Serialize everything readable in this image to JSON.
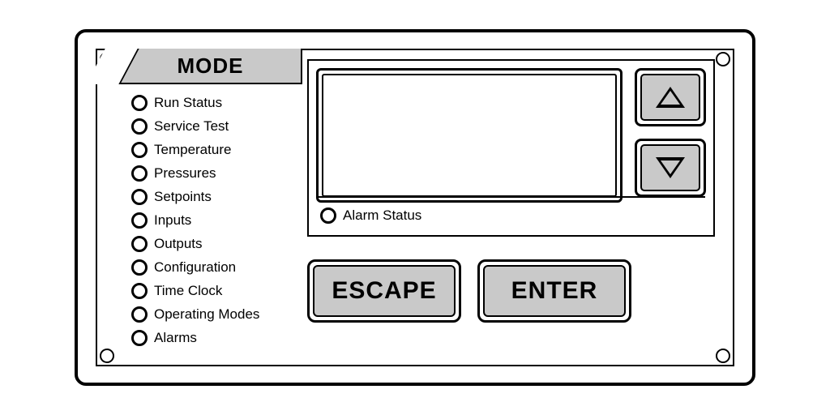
{
  "mode_header": "MODE",
  "mode_items": [
    "Run Status",
    "Service Test",
    "Temperature",
    "Pressures",
    "Setpoints",
    "Inputs",
    "Outputs",
    "Configuration",
    "Time Clock",
    "Operating Modes",
    "Alarms"
  ],
  "alarm_status_label": "Alarm Status",
  "buttons": {
    "escape": "ESCAPE",
    "enter": "ENTER"
  }
}
